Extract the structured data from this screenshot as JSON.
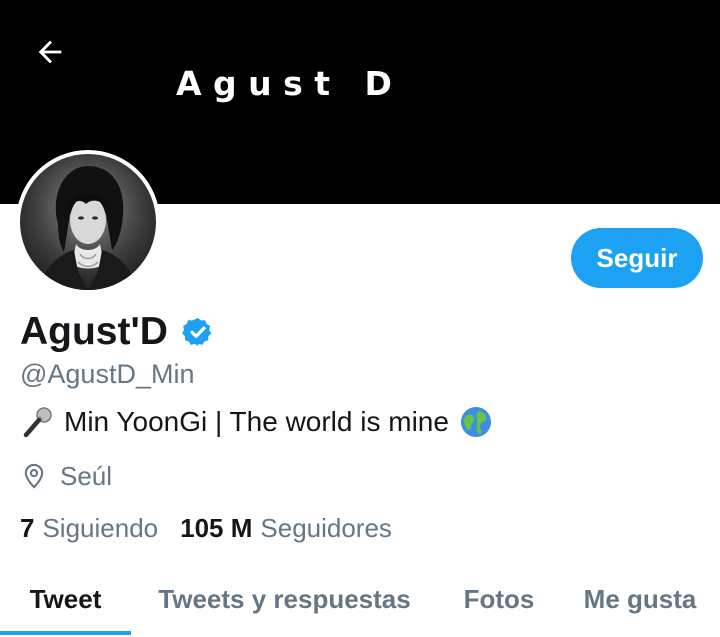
{
  "header": {
    "banner_text": "A g u s t   D",
    "background_color": "#000000"
  },
  "profile": {
    "display_name": "Agust'D",
    "verified": true,
    "handle": "@AgustD_Min",
    "bio_text": "Min YoonGi | The world is mine",
    "bio_icons": [
      "microphone-icon",
      "globe-icon"
    ],
    "location": "Seúl",
    "following_count": "7",
    "following_label": "Siguiendo",
    "followers_count": "105 M",
    "followers_label": "Seguidores"
  },
  "actions": {
    "follow_label": "Seguir"
  },
  "tabs": [
    {
      "label": "Tweet",
      "active": true
    },
    {
      "label": "Tweets y respuestas",
      "active": false
    },
    {
      "label": "Fotos",
      "active": false
    },
    {
      "label": "Me gusta",
      "active": false
    }
  ],
  "colors": {
    "accent": "#1da1f2",
    "text_primary": "#14171a",
    "text_secondary": "#657786"
  }
}
